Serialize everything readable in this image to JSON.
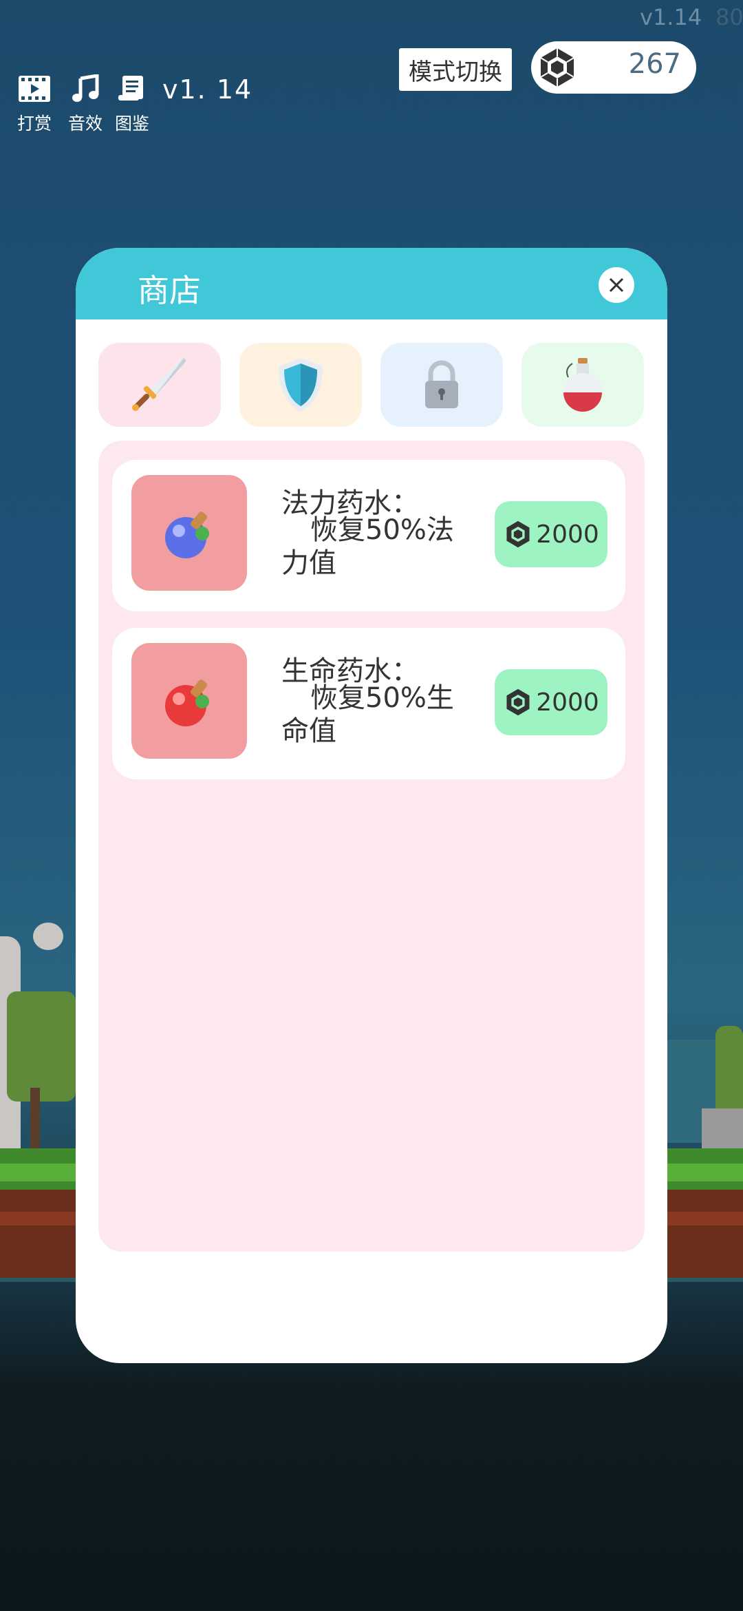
{
  "hud": {
    "version_corner": "v1.14",
    "version_corner_cut": "80",
    "reward_label": "打赏",
    "sound_label": "音效",
    "gallery_label": "图鉴",
    "version_label": "v1. 14",
    "mode_switch_label": "模式切换",
    "gem_count": "267"
  },
  "shop": {
    "title": "商店",
    "tabs": [
      {
        "name": "sword",
        "color": "#fde4ea"
      },
      {
        "name": "shield",
        "color": "#fff1df"
      },
      {
        "name": "lock",
        "color": "#e5f2fe"
      },
      {
        "name": "potion",
        "color": "#e7fbed"
      }
    ],
    "items": [
      {
        "name": "法力药水：",
        "desc": "恢复50%法力值",
        "price": "2000",
        "orb_color": "#5b6fe6"
      },
      {
        "name": "生命药水：",
        "desc": "恢复50%生命值",
        "price": "2000",
        "orb_color": "#e8393b"
      }
    ]
  },
  "colors": {
    "header": "#40c8d8",
    "price_bg": "#9ef3c3",
    "thumb_bg": "#f29d9f",
    "list_bg": "#fde8ee"
  }
}
